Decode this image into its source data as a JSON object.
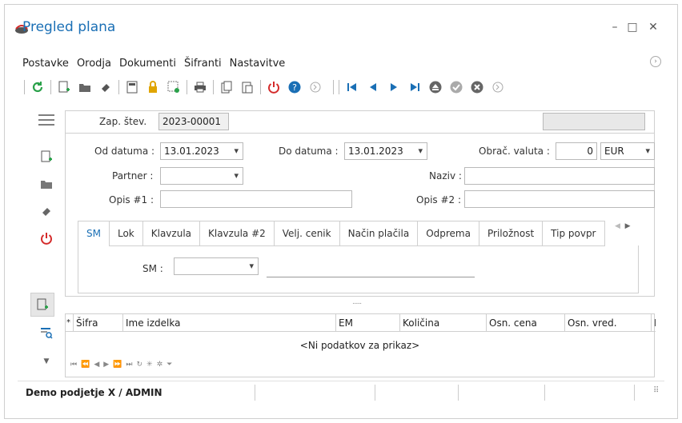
{
  "window": {
    "title": "Pregled plana",
    "minimize": "–",
    "maximize": "□",
    "close": "✕"
  },
  "menu": [
    "Postavke",
    "Orodja",
    "Dokumenti",
    "Šifranti",
    "Nastavitve"
  ],
  "header": {
    "zap_label": "Zap. štev.",
    "zap_value": "2023-00001"
  },
  "form": {
    "od_label": "Od datuma :",
    "od_value": "13.01.2023",
    "do_label": "Do datuma :",
    "do_value": "13.01.2023",
    "valuta_label": "Obrač. valuta :",
    "valuta_amount": "0",
    "valuta_currency": "EUR",
    "partner_label": "Partner :",
    "partner_value": "",
    "naziv_label": "Naziv :",
    "naziv_value": "",
    "opis1_label": "Opis #1 :",
    "opis1_value": "",
    "opis2_label": "Opis #2 :",
    "opis2_value": ""
  },
  "tabs": [
    "SM",
    "Lok",
    "Klavzula",
    "Klavzula #2",
    "Velj. cenik",
    "Način plačila",
    "Odprema",
    "Priložnost",
    "Tip povpr"
  ],
  "tab_sm": {
    "sm_label": "SM :",
    "sm_value": ""
  },
  "splitter": "......",
  "grid": {
    "columns": [
      "Šifra",
      "Ime izdelka",
      "EM",
      "Količina",
      "Osn. cena",
      "Osn. vred.",
      "R."
    ],
    "empty_text": "<Ni podatkov za prikaz>"
  },
  "status": {
    "company": "Demo podjetje X / ADMIN"
  },
  "colors": {
    "accent": "#1a6fb5",
    "refresh": "#2aa14a",
    "power": "#d42a2a",
    "lock": "#e0a500"
  }
}
